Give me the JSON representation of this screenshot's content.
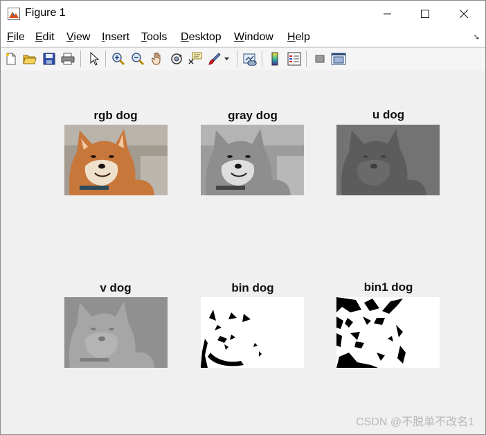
{
  "window": {
    "title": "Figure 1",
    "icon": "matlab-figure-icon",
    "controls": [
      "minimize-icon",
      "maximize-icon",
      "close-icon"
    ]
  },
  "menu": {
    "items": [
      {
        "label": "File",
        "mnemonic": "F"
      },
      {
        "label": "Edit",
        "mnemonic": "E"
      },
      {
        "label": "View",
        "mnemonic": "V"
      },
      {
        "label": "Insert",
        "mnemonic": "I"
      },
      {
        "label": "Tools",
        "mnemonic": "T"
      },
      {
        "label": "Desktop",
        "mnemonic": "D"
      },
      {
        "label": "Window",
        "mnemonic": "W"
      },
      {
        "label": "Help",
        "mnemonic": "H"
      }
    ],
    "dock_icon": "dock-arrow-icon"
  },
  "toolbar": {
    "icons": [
      "new-figure-icon",
      "open-file-icon",
      "save-icon",
      "print-icon",
      "edit-plot-arrow-icon",
      "zoom-in-icon",
      "zoom-out-icon",
      "pan-hand-icon",
      "rotate-3d-icon",
      "data-cursor-icon",
      "brush-icon",
      "brush-dropdown-icon",
      "link-plot-icon",
      "insert-colorbar-icon",
      "insert-legend-icon",
      "hide-plot-tools-icon",
      "show-plot-tools-icon"
    ]
  },
  "subplots": [
    {
      "title": "rgb dog",
      "kind": "rgb"
    },
    {
      "title": "gray dog",
      "kind": "gray"
    },
    {
      "title": "u dog",
      "kind": "u"
    },
    {
      "title": "v dog",
      "kind": "v"
    },
    {
      "title": "bin dog",
      "kind": "bin"
    },
    {
      "title": "bin1 dog",
      "kind": "bin1"
    }
  ],
  "watermark": "CSDN @不脱单不改名1",
  "colors": {
    "window_bg": "#f0f0f0",
    "rgb_fur": "#c8773a",
    "gray_fur": "#9a9a9a",
    "u_bg": "#6e6e6e",
    "v_bg": "#8e8e8e"
  }
}
